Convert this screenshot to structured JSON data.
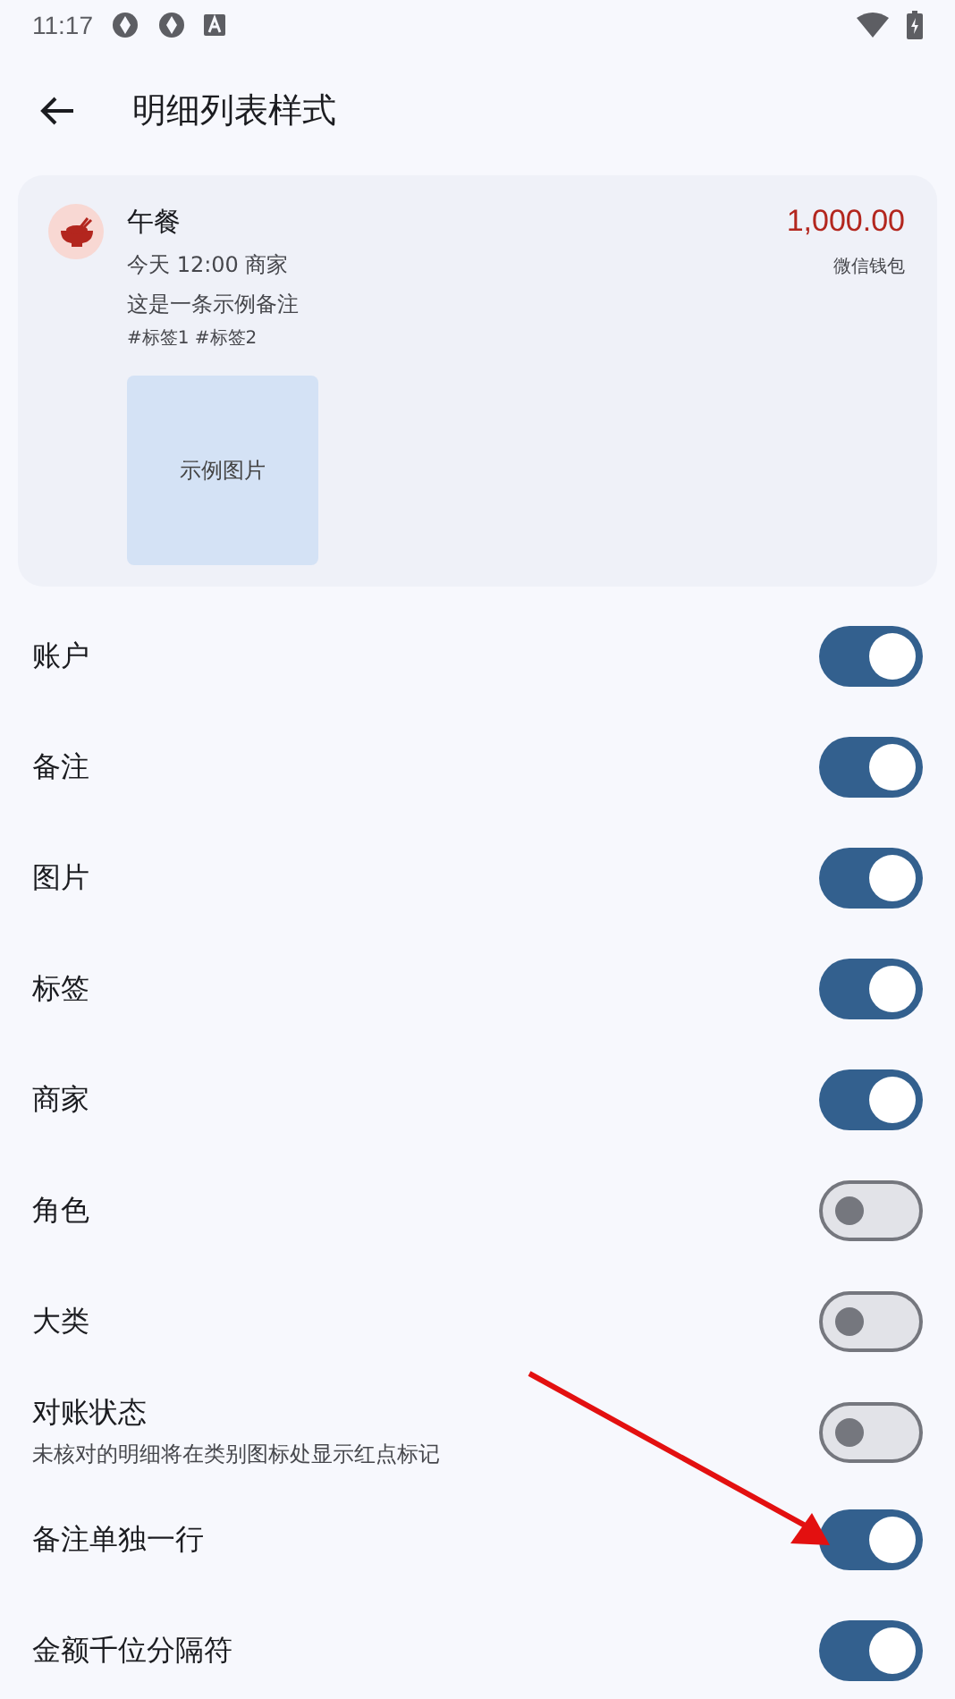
{
  "status_bar": {
    "time": "11:17"
  },
  "app_bar": {
    "title": "明细列表样式"
  },
  "preview": {
    "category": "午餐",
    "meta": "今天 12:00 商家",
    "note": "这是一条示例备注",
    "tags": "#标签1 #标签2",
    "image_label": "示例图片",
    "amount": "1,000.00",
    "account": "微信钱包"
  },
  "settings": [
    {
      "label": "账户",
      "on": true
    },
    {
      "label": "备注",
      "on": true
    },
    {
      "label": "图片",
      "on": true
    },
    {
      "label": "标签",
      "on": true
    },
    {
      "label": "商家",
      "on": true
    },
    {
      "label": "角色",
      "on": false
    },
    {
      "label": "大类",
      "on": false
    },
    {
      "label": "对账状态",
      "description": "未核对的明细将在类别图标处显示红点标记",
      "on": false
    },
    {
      "label": "备注单独一行",
      "on": true
    },
    {
      "label": "金额千位分隔符",
      "on": true
    }
  ]
}
